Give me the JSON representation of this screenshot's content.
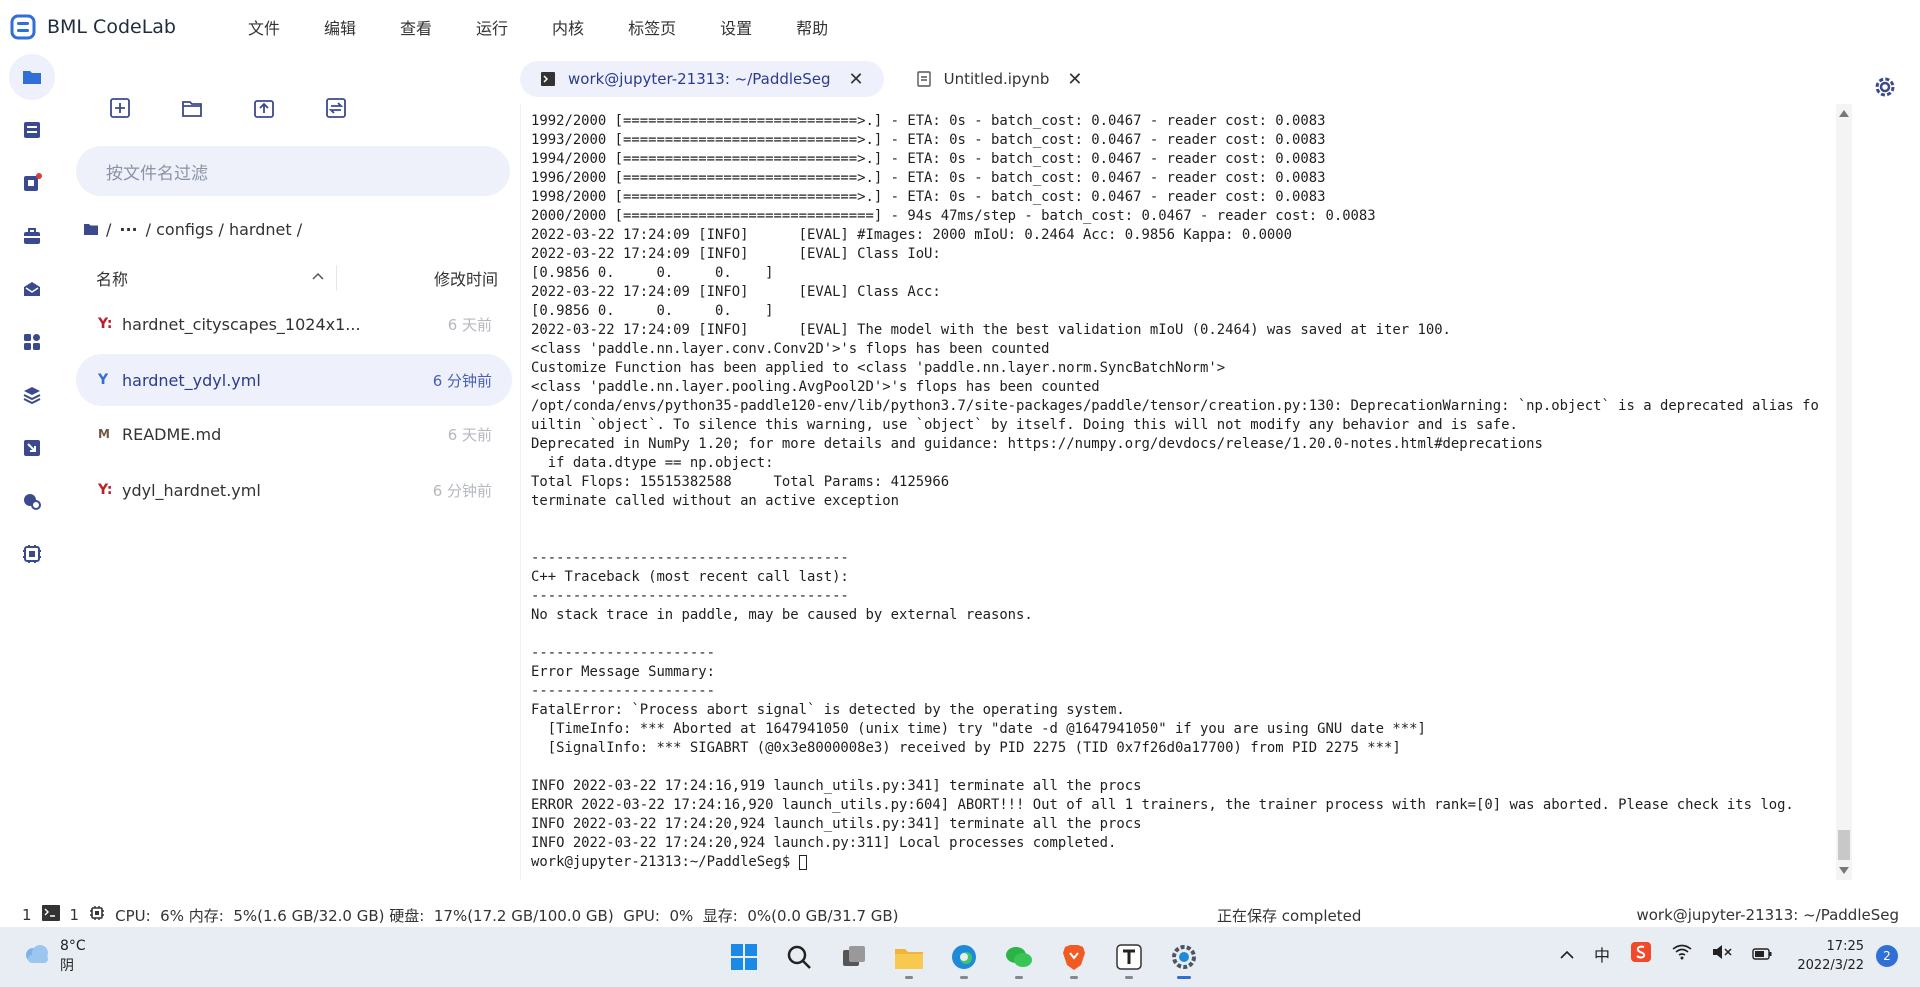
{
  "app": {
    "title": "BML CodeLab"
  },
  "menu": [
    "文件",
    "编辑",
    "查看",
    "运行",
    "内核",
    "标签页",
    "设置",
    "帮助"
  ],
  "file_panel": {
    "search_placeholder": "按文件名过滤",
    "breadcrumb": [
      "/",
      "···",
      "/ configs / hardnet /"
    ],
    "col_name": "名称",
    "col_time": "修改时间",
    "files": [
      {
        "icon": "Y:",
        "name": "hardnet_cityscapes_1024x1...",
        "time": "6 天前",
        "active": false
      },
      {
        "icon": "Y",
        "name": "hardnet_ydyl.yml",
        "time": "6 分钟前",
        "active": true
      },
      {
        "icon": "M",
        "name": "README.md",
        "time": "6 天前",
        "active": false
      },
      {
        "icon": "Y:",
        "name": "ydyl_hardnet.yml",
        "time": "6 分钟前",
        "active": false
      }
    ]
  },
  "tabs": [
    {
      "label": "work@jupyter-21313: ~/PaddleSeg",
      "active": true
    },
    {
      "label": "Untitled.ipynb",
      "active": false
    }
  ],
  "terminal": {
    "lines": [
      "1992/2000 [============================>.] - ETA: 0s - batch_cost: 0.0467 - reader cost: 0.0083",
      "1993/2000 [============================>.] - ETA: 0s - batch_cost: 0.0467 - reader cost: 0.0083",
      "1994/2000 [============================>.] - ETA: 0s - batch_cost: 0.0467 - reader cost: 0.0083",
      "1996/2000 [============================>.] - ETA: 0s - batch_cost: 0.0467 - reader cost: 0.0083",
      "1998/2000 [============================>.] - ETA: 0s - batch_cost: 0.0467 - reader cost: 0.0083",
      "2000/2000 [==============================] - 94s 47ms/step - batch_cost: 0.0467 - reader cost: 0.0083",
      "2022-03-22 17:24:09 [INFO]      [EVAL] #Images: 2000 mIoU: 0.2464 Acc: 0.9856 Kappa: 0.0000",
      "2022-03-22 17:24:09 [INFO]      [EVAL] Class IoU:",
      "[0.9856 0.     0.     0.    ]",
      "2022-03-22 17:24:09 [INFO]      [EVAL] Class Acc:",
      "[0.9856 0.     0.     0.    ]",
      "2022-03-22 17:24:09 [INFO]      [EVAL] The model with the best validation mIoU (0.2464) was saved at iter 100.",
      "<class 'paddle.nn.layer.conv.Conv2D'>'s flops has been counted",
      "Customize Function has been applied to <class 'paddle.nn.layer.norm.SyncBatchNorm'>",
      "<class 'paddle.nn.layer.pooling.AvgPool2D'>'s flops has been counted",
      "/opt/conda/envs/python35-paddle120-env/lib/python3.7/site-packages/paddle/tensor/creation.py:130: DeprecationWarning: `np.object` is a deprecated alias for the b",
      "uiltin `object`. To silence this warning, use `object` by itself. Doing this will not modify any behavior and is safe.",
      "Deprecated in NumPy 1.20; for more details and guidance: https://numpy.org/devdocs/release/1.20.0-notes.html#deprecations",
      "  if data.dtype == np.object:",
      "Total Flops: 15515382588     Total Params: 4125966",
      "terminate called without an active exception",
      "",
      "",
      "--------------------------------------",
      "C++ Traceback (most recent call last):",
      "--------------------------------------",
      "No stack trace in paddle, may be caused by external reasons.",
      "",
      "----------------------",
      "Error Message Summary:",
      "----------------------",
      "FatalError: `Process abort signal` is detected by the operating system.",
      "  [TimeInfo: *** Aborted at 1647941050 (unix time) try \"date -d @1647941050\" if you are using GNU date ***]",
      "  [SignalInfo: *** SIGABRT (@0x3e8000008e3) received by PID 2275 (TID 0x7f26d0a17700) from PID 2275 ***]",
      "",
      "INFO 2022-03-22 17:24:16,919 launch_utils.py:341] terminate all the procs",
      "ERROR 2022-03-22 17:24:16,920 launch_utils.py:604] ABORT!!! Out of all 1 trainers, the trainer process with rank=[0] was aborted. Please check its log.",
      "INFO 2022-03-22 17:24:20,924 launch_utils.py:341] terminate all the procs",
      "INFO 2022-03-22 17:24:20,924 launch.py:311] Local processes completed.",
      "work@jupyter-21313:~/PaddleSeg$ "
    ]
  },
  "statusbar": {
    "left_num1": "1",
    "left_num2": "1",
    "resources": "CPU:  6% 内存:  5%(1.6 GB/32.0 GB) 硬盘:  17%(17.2 GB/100.0 GB)  GPU:  0%  显存:  0%(0.0 GB/31.7 GB)",
    "save_status": "正在保存 completed",
    "session": "work@jupyter-21313: ~/PaddleSeg"
  },
  "taskbar": {
    "temperature": "8°C",
    "weather": "阴",
    "ime": "中",
    "time": "17:25",
    "date": "2022/3/22",
    "notifications": "2"
  }
}
